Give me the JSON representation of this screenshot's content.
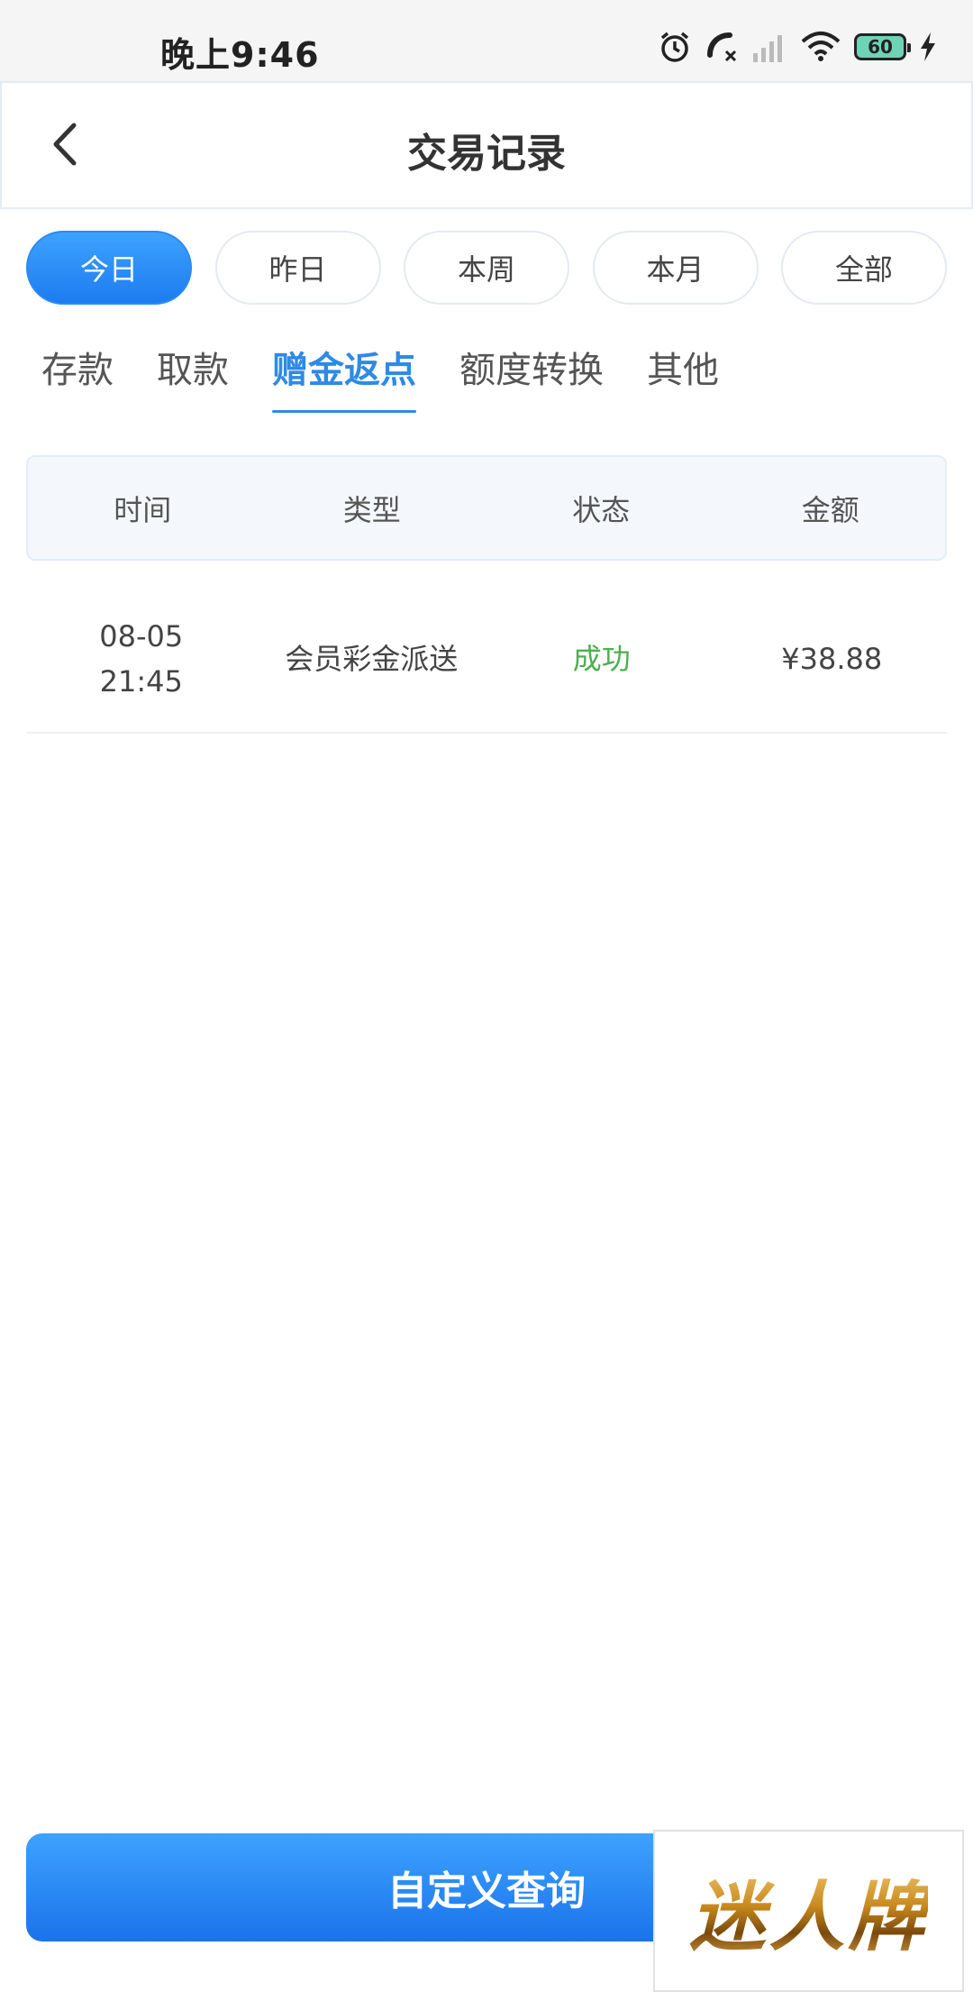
{
  "status_bar": {
    "time": "晚上9:46",
    "battery": "60",
    "icons": [
      "alarm-icon",
      "missed-call-icon",
      "signal-icon",
      "wifi-icon",
      "battery-icon",
      "charging-icon"
    ]
  },
  "header": {
    "title": "交易记录",
    "back_icon": "chevron-left-icon"
  },
  "date_filters": {
    "items": [
      "今日",
      "昨日",
      "本周",
      "本月",
      "全部"
    ],
    "selected": "今日"
  },
  "category_tabs": {
    "items": [
      "存款",
      "取款",
      "赠金返点",
      "额度转换",
      "其他"
    ],
    "selected": "赠金返点"
  },
  "table": {
    "columns": [
      "时间",
      "类型",
      "状态",
      "金额"
    ],
    "rows": [
      {
        "date": "08-05",
        "time": "21:45",
        "type": "会员彩金派送",
        "status": "成功",
        "amount": "¥38.88"
      }
    ]
  },
  "footer": {
    "query_label": "自定义查询"
  },
  "watermark": {
    "text": "迷人牌"
  },
  "colors": {
    "accent": "#2e8ae6",
    "success": "#4caf50",
    "button": "#1a73ea"
  }
}
